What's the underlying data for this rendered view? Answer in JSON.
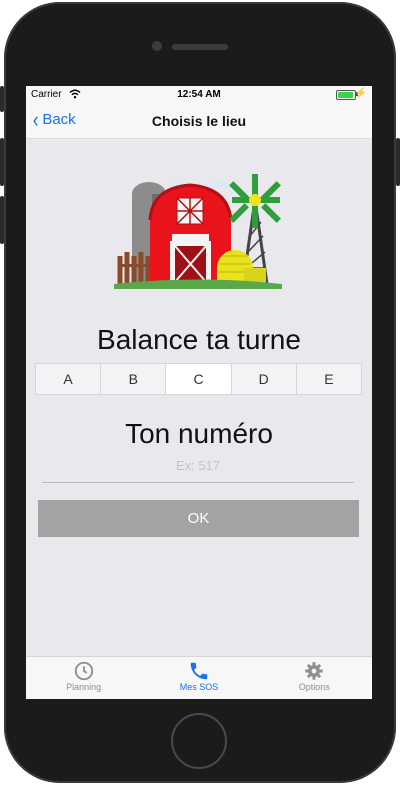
{
  "status_bar": {
    "carrier": "Carrier",
    "time": "12:54 AM"
  },
  "nav": {
    "back_label": "Back",
    "title": "Choisis le lieu"
  },
  "section1": {
    "title": "Balance ta turne"
  },
  "segments": [
    "A",
    "B",
    "C",
    "D",
    "E"
  ],
  "selected_segment": "C",
  "section2": {
    "title": "Ton numéro"
  },
  "number_input": {
    "value": "",
    "placeholder": "Ex: 517"
  },
  "ok_button": {
    "label": "OK"
  },
  "tabbar": {
    "items": [
      {
        "label": "Planning",
        "icon": "clock-icon",
        "active": false
      },
      {
        "label": "Mes SOS",
        "icon": "phone-icon",
        "active": true
      },
      {
        "label": "Options",
        "icon": "gear-icon",
        "active": false
      }
    ]
  },
  "colors": {
    "accent": "#1a73e8",
    "ok_button": "#a3a3a3",
    "background": "#e8e8ed"
  }
}
